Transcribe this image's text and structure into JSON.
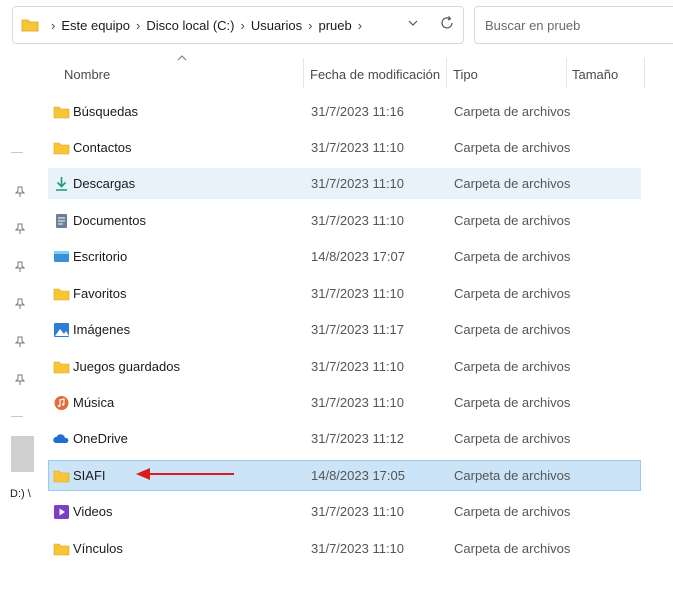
{
  "address_bar": {
    "crumbs": [
      "Este equipo",
      "Disco local (C:)",
      "Usuarios",
      "prueb"
    ],
    "separator": "›"
  },
  "search": {
    "placeholder": "Buscar en prueb"
  },
  "columns": {
    "name": "Nombre",
    "date": "Fecha de modificación",
    "type": "Tipo",
    "size": "Tamaño"
  },
  "nav": {
    "drive_text": "D:) \\"
  },
  "files": [
    {
      "name": "Búsquedas",
      "date": "31/7/2023 11:16",
      "type": "Carpeta de archivos",
      "icon": "folder-icon"
    },
    {
      "name": "Contactos",
      "date": "31/7/2023 11:10",
      "type": "Carpeta de archivos",
      "icon": "folder-icon"
    },
    {
      "name": "Descargas",
      "date": "31/7/2023 11:10",
      "type": "Carpeta de archivos",
      "icon": "download-icon"
    },
    {
      "name": "Documentos",
      "date": "31/7/2023 11:10",
      "type": "Carpeta de archivos",
      "icon": "document-icon"
    },
    {
      "name": "Escritorio",
      "date": "14/8/2023 17:07",
      "type": "Carpeta de archivos",
      "icon": "desktop-icon"
    },
    {
      "name": "Favoritos",
      "date": "31/7/2023 11:10",
      "type": "Carpeta de archivos",
      "icon": "folder-icon"
    },
    {
      "name": "Imágenes",
      "date": "31/7/2023 11:17",
      "type": "Carpeta de archivos",
      "icon": "pictures-icon"
    },
    {
      "name": "Juegos guardados",
      "date": "31/7/2023 11:10",
      "type": "Carpeta de archivos",
      "icon": "folder-icon"
    },
    {
      "name": "Música",
      "date": "31/7/2023 11:10",
      "type": "Carpeta de archivos",
      "icon": "music-icon"
    },
    {
      "name": "OneDrive",
      "date": "31/7/2023 11:12",
      "type": "Carpeta de archivos",
      "icon": "onedrive-icon"
    },
    {
      "name": "SIAFI",
      "date": "14/8/2023 17:05",
      "type": "Carpeta de archivos",
      "icon": "folder-icon"
    },
    {
      "name": "Videos",
      "date": "31/7/2023 11:10",
      "type": "Carpeta de archivos",
      "icon": "videos-icon"
    },
    {
      "name": "Vínculos",
      "date": "31/7/2023 11:10",
      "type": "Carpeta de archivos",
      "icon": "folder-icon"
    }
  ],
  "colors": {
    "folder": "#f8c537",
    "selected_row": "#cce4f7",
    "hover_row": "#e8f2fb",
    "arrow": "#e0191c"
  }
}
